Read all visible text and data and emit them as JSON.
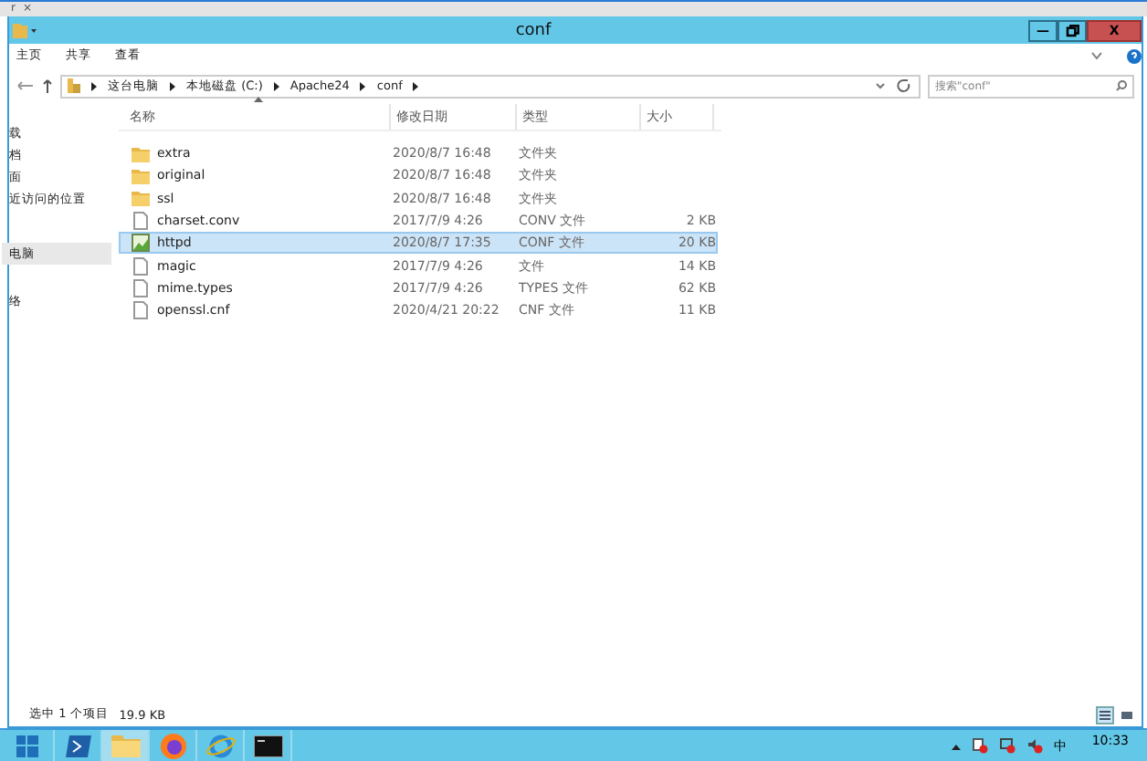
{
  "browser_tab": {
    "label": "r",
    "close": "×"
  },
  "window": {
    "title": "conf",
    "minimize": "—",
    "close": "X"
  },
  "ribbon_tabs": [
    {
      "label": "主页",
      "selected": false
    },
    {
      "label": "共享",
      "selected": false
    },
    {
      "label": "查看",
      "selected": false
    }
  ],
  "address": {
    "path": [
      "这台电脑",
      "本地磁盘 (C:)",
      "Apache24",
      "conf"
    ]
  },
  "search": {
    "placeholder": "搜索\"conf\""
  },
  "sidebar": {
    "items": [
      {
        "label": "载",
        "selected": false
      },
      {
        "label": "档",
        "selected": false
      },
      {
        "label": "面",
        "selected": false
      },
      {
        "label": "近访问的位置",
        "selected": false
      },
      {
        "label": "电脑",
        "selected": true
      },
      {
        "label": "络",
        "selected": false
      }
    ]
  },
  "table": {
    "columns": [
      "名称",
      "修改日期",
      "类型",
      "大小"
    ],
    "rows": [
      {
        "kind": "folder",
        "name": "extra",
        "date": "2020/8/7 16:48",
        "type": "文件夹",
        "size": "",
        "selected": false
      },
      {
        "kind": "folder",
        "name": "original",
        "date": "2020/8/7 16:48",
        "type": "文件夹",
        "size": "",
        "selected": false
      },
      {
        "kind": "folder",
        "name": "ssl",
        "date": "2020/8/7 16:48",
        "type": "文件夹",
        "size": "",
        "selected": false
      },
      {
        "kind": "file",
        "name": "charset.conv",
        "date": "2017/7/9 4:26",
        "type": "CONV 文件",
        "size": "2 KB",
        "selected": false
      },
      {
        "kind": "image",
        "name": "httpd",
        "date": "2020/8/7 17:35",
        "type": "CONF 文件",
        "size": "20 KB",
        "selected": true
      },
      {
        "kind": "file",
        "name": "magic",
        "date": "2017/7/9 4:26",
        "type": "文件",
        "size": "14 KB",
        "selected": false
      },
      {
        "kind": "file",
        "name": "mime.types",
        "date": "2017/7/9 4:26",
        "type": "TYPES 文件",
        "size": "62 KB",
        "selected": false
      },
      {
        "kind": "file",
        "name": "openssl.cnf",
        "date": "2020/4/21 20:22",
        "type": "CNF 文件",
        "size": "11 KB",
        "selected": false
      }
    ]
  },
  "status_bar": {
    "selection": "选中 1 个项目",
    "size": "19.9 KB"
  },
  "taskbar": {
    "apps": [
      {
        "kind": "powershell",
        "selected": false
      },
      {
        "kind": "explorer",
        "selected": true
      },
      {
        "kind": "firefox",
        "selected": false
      },
      {
        "kind": "ie",
        "selected": false
      },
      {
        "kind": "cmd",
        "selected": false
      }
    ],
    "ime": "中",
    "time": "10:33"
  }
}
